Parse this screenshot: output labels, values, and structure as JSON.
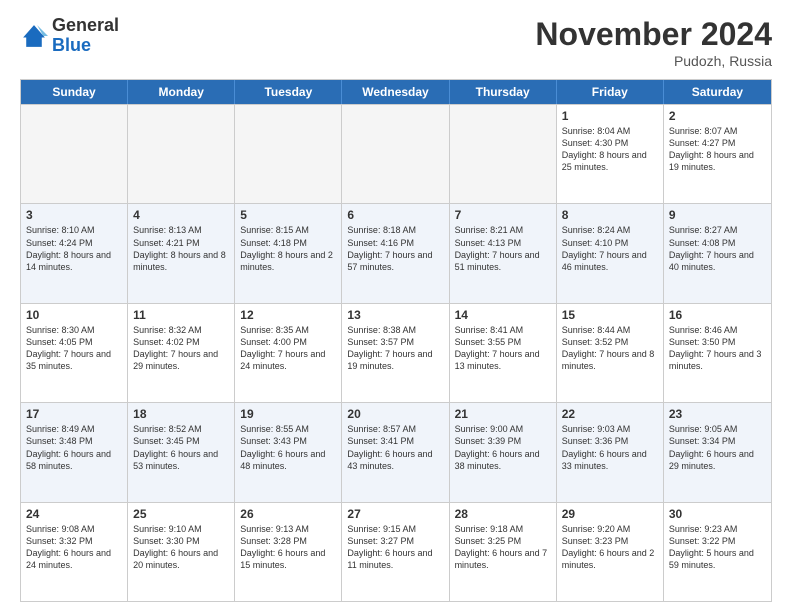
{
  "logo": {
    "general": "General",
    "blue": "Blue"
  },
  "header": {
    "month": "November 2024",
    "location": "Pudozh, Russia"
  },
  "weekdays": [
    "Sunday",
    "Monday",
    "Tuesday",
    "Wednesday",
    "Thursday",
    "Friday",
    "Saturday"
  ],
  "rows": [
    [
      {
        "day": "",
        "info": "",
        "empty": true
      },
      {
        "day": "",
        "info": "",
        "empty": true
      },
      {
        "day": "",
        "info": "",
        "empty": true
      },
      {
        "day": "",
        "info": "",
        "empty": true
      },
      {
        "day": "",
        "info": "",
        "empty": true
      },
      {
        "day": "1",
        "info": "Sunrise: 8:04 AM\nSunset: 4:30 PM\nDaylight: 8 hours\nand 25 minutes."
      },
      {
        "day": "2",
        "info": "Sunrise: 8:07 AM\nSunset: 4:27 PM\nDaylight: 8 hours\nand 19 minutes."
      }
    ],
    [
      {
        "day": "3",
        "info": "Sunrise: 8:10 AM\nSunset: 4:24 PM\nDaylight: 8 hours\nand 14 minutes."
      },
      {
        "day": "4",
        "info": "Sunrise: 8:13 AM\nSunset: 4:21 PM\nDaylight: 8 hours\nand 8 minutes."
      },
      {
        "day": "5",
        "info": "Sunrise: 8:15 AM\nSunset: 4:18 PM\nDaylight: 8 hours\nand 2 minutes."
      },
      {
        "day": "6",
        "info": "Sunrise: 8:18 AM\nSunset: 4:16 PM\nDaylight: 7 hours\nand 57 minutes."
      },
      {
        "day": "7",
        "info": "Sunrise: 8:21 AM\nSunset: 4:13 PM\nDaylight: 7 hours\nand 51 minutes."
      },
      {
        "day": "8",
        "info": "Sunrise: 8:24 AM\nSunset: 4:10 PM\nDaylight: 7 hours\nand 46 minutes."
      },
      {
        "day": "9",
        "info": "Sunrise: 8:27 AM\nSunset: 4:08 PM\nDaylight: 7 hours\nand 40 minutes."
      }
    ],
    [
      {
        "day": "10",
        "info": "Sunrise: 8:30 AM\nSunset: 4:05 PM\nDaylight: 7 hours\nand 35 minutes."
      },
      {
        "day": "11",
        "info": "Sunrise: 8:32 AM\nSunset: 4:02 PM\nDaylight: 7 hours\nand 29 minutes."
      },
      {
        "day": "12",
        "info": "Sunrise: 8:35 AM\nSunset: 4:00 PM\nDaylight: 7 hours\nand 24 minutes."
      },
      {
        "day": "13",
        "info": "Sunrise: 8:38 AM\nSunset: 3:57 PM\nDaylight: 7 hours\nand 19 minutes."
      },
      {
        "day": "14",
        "info": "Sunrise: 8:41 AM\nSunset: 3:55 PM\nDaylight: 7 hours\nand 13 minutes."
      },
      {
        "day": "15",
        "info": "Sunrise: 8:44 AM\nSunset: 3:52 PM\nDaylight: 7 hours\nand 8 minutes."
      },
      {
        "day": "16",
        "info": "Sunrise: 8:46 AM\nSunset: 3:50 PM\nDaylight: 7 hours\nand 3 minutes."
      }
    ],
    [
      {
        "day": "17",
        "info": "Sunrise: 8:49 AM\nSunset: 3:48 PM\nDaylight: 6 hours\nand 58 minutes."
      },
      {
        "day": "18",
        "info": "Sunrise: 8:52 AM\nSunset: 3:45 PM\nDaylight: 6 hours\nand 53 minutes."
      },
      {
        "day": "19",
        "info": "Sunrise: 8:55 AM\nSunset: 3:43 PM\nDaylight: 6 hours\nand 48 minutes."
      },
      {
        "day": "20",
        "info": "Sunrise: 8:57 AM\nSunset: 3:41 PM\nDaylight: 6 hours\nand 43 minutes."
      },
      {
        "day": "21",
        "info": "Sunrise: 9:00 AM\nSunset: 3:39 PM\nDaylight: 6 hours\nand 38 minutes."
      },
      {
        "day": "22",
        "info": "Sunrise: 9:03 AM\nSunset: 3:36 PM\nDaylight: 6 hours\nand 33 minutes."
      },
      {
        "day": "23",
        "info": "Sunrise: 9:05 AM\nSunset: 3:34 PM\nDaylight: 6 hours\nand 29 minutes."
      }
    ],
    [
      {
        "day": "24",
        "info": "Sunrise: 9:08 AM\nSunset: 3:32 PM\nDaylight: 6 hours\nand 24 minutes."
      },
      {
        "day": "25",
        "info": "Sunrise: 9:10 AM\nSunset: 3:30 PM\nDaylight: 6 hours\nand 20 minutes."
      },
      {
        "day": "26",
        "info": "Sunrise: 9:13 AM\nSunset: 3:28 PM\nDaylight: 6 hours\nand 15 minutes."
      },
      {
        "day": "27",
        "info": "Sunrise: 9:15 AM\nSunset: 3:27 PM\nDaylight: 6 hours\nand 11 minutes."
      },
      {
        "day": "28",
        "info": "Sunrise: 9:18 AM\nSunset: 3:25 PM\nDaylight: 6 hours\nand 7 minutes."
      },
      {
        "day": "29",
        "info": "Sunrise: 9:20 AM\nSunset: 3:23 PM\nDaylight: 6 hours\nand 2 minutes."
      },
      {
        "day": "30",
        "info": "Sunrise: 9:23 AM\nSunset: 3:22 PM\nDaylight: 5 hours\nand 59 minutes."
      }
    ]
  ]
}
